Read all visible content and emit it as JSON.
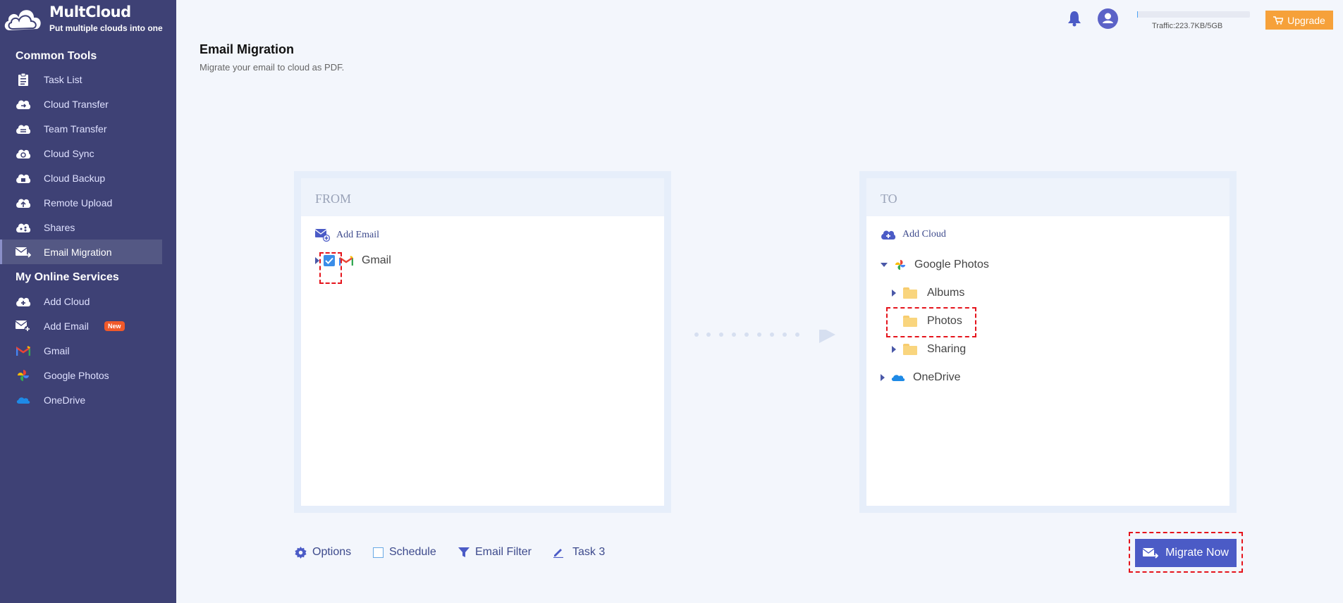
{
  "brand": {
    "name": "MultCloud",
    "tagline": "Put multiple clouds into one"
  },
  "sidebar": {
    "common_title": "Common Tools",
    "common_items": [
      {
        "label": "Task List",
        "icon": "task-list-icon"
      },
      {
        "label": "Cloud Transfer",
        "icon": "cloud-transfer-icon"
      },
      {
        "label": "Team Transfer",
        "icon": "team-transfer-icon"
      },
      {
        "label": "Cloud Sync",
        "icon": "cloud-sync-icon"
      },
      {
        "label": "Cloud Backup",
        "icon": "cloud-backup-icon"
      },
      {
        "label": "Remote Upload",
        "icon": "remote-upload-icon"
      },
      {
        "label": "Shares",
        "icon": "shares-icon"
      },
      {
        "label": "Email Migration",
        "icon": "email-migration-icon",
        "active": true
      }
    ],
    "services_title": "My Online Services",
    "service_items": [
      {
        "label": "Add Cloud",
        "icon": "add-cloud-icon"
      },
      {
        "label": "Add Email",
        "icon": "add-email-icon",
        "badge": "New"
      },
      {
        "label": "Gmail",
        "icon": "gmail-icon"
      },
      {
        "label": "Google Photos",
        "icon": "google-photos-icon"
      },
      {
        "label": "OneDrive",
        "icon": "onedrive-icon"
      }
    ]
  },
  "header": {
    "traffic": "Traffic:223.7KB/5GB",
    "upgrade_label": "Upgrade"
  },
  "page": {
    "title": "Email Migration",
    "subtitle": "Migrate your email to cloud as PDF."
  },
  "from_panel": {
    "title": "FROM",
    "add_label": "Add Email",
    "items": [
      {
        "label": "Gmail",
        "checked": true
      }
    ]
  },
  "to_panel": {
    "title": "TO",
    "add_label": "Add Cloud",
    "google_photos": "Google Photos",
    "folders": [
      "Albums",
      "Photos",
      "Sharing"
    ],
    "onedrive": "OneDrive"
  },
  "bottom": {
    "options_label": "Options",
    "schedule_label": "Schedule",
    "filter_label": "Email Filter",
    "task_label": "Task 3",
    "migrate_label": "Migrate Now"
  },
  "colors": {
    "sidebar": "#3e4175",
    "accent": "#4b5bc6",
    "upgrade": "#f6a13a",
    "highlight": "#e5141c"
  }
}
